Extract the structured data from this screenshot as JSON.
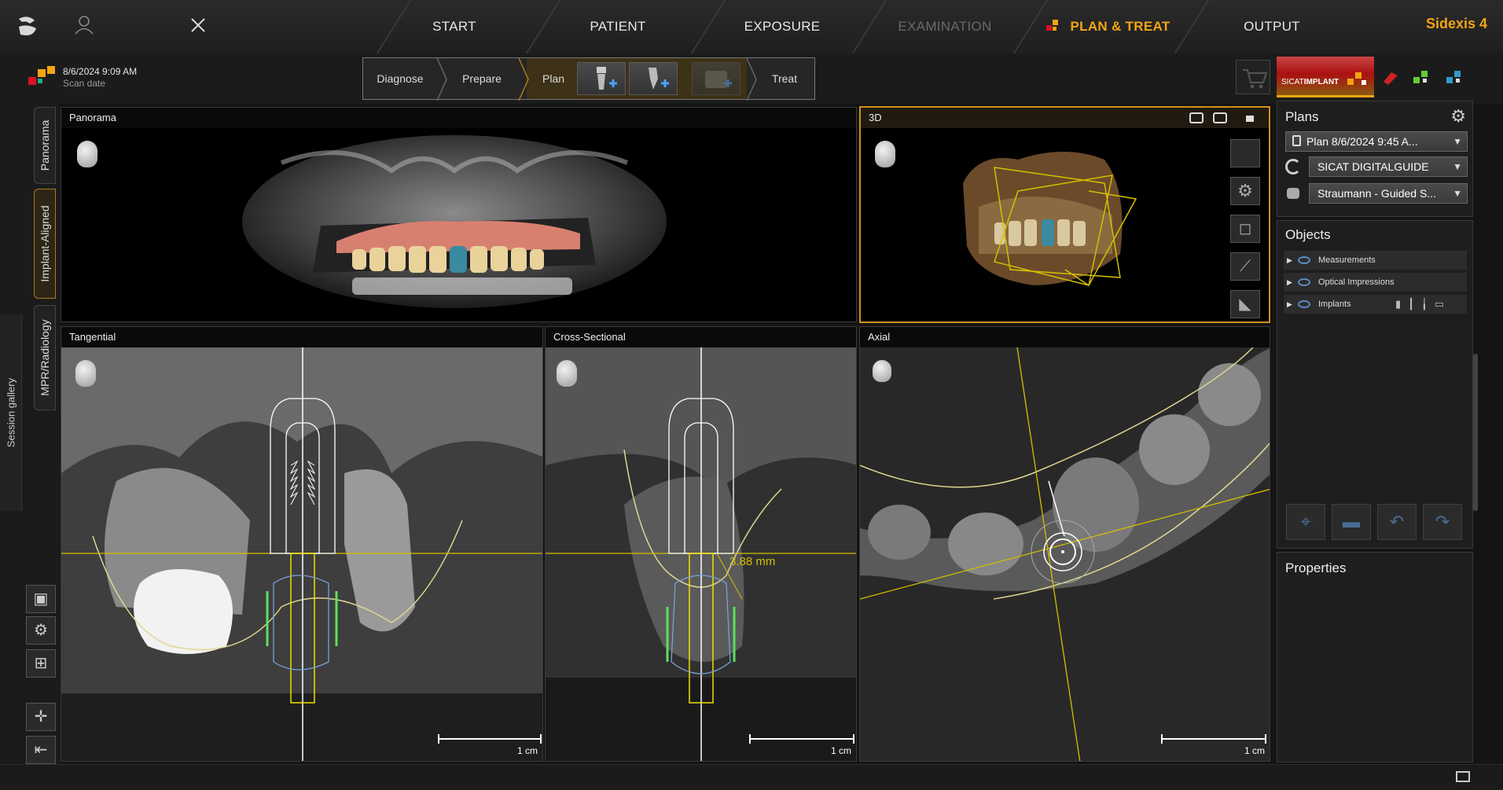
{
  "brand": "Sidexis 4",
  "nav": {
    "start": "START",
    "patient": "PATIENT",
    "exposure": "EXPOSURE",
    "examination": "EXAMINATION",
    "plan_treat": "PLAN & TREAT",
    "output": "OUTPUT"
  },
  "scan": {
    "date": "8/6/2024 9:09 AM",
    "label": "Scan date"
  },
  "workflow": {
    "diagnose": "Diagnose",
    "prepare": "Prepare",
    "plan": "Plan",
    "treat": "Treat"
  },
  "views": {
    "panorama": "Panorama",
    "three_d": "3D",
    "tangential": "Tangential",
    "cross_sectional": "Cross-Sectional",
    "axial": "Axial"
  },
  "measurement": "3.88 mm",
  "scale_label": "1 cm",
  "left_tabs": {
    "panorama": "Panorama",
    "implant_aligned": "Implant-Aligned",
    "mpr": "MPR/Radiology",
    "session_gallery": "Session gallery"
  },
  "sicat": {
    "prefix": "SICAT",
    "name": "IMPLANT"
  },
  "right_panel": {
    "plans_title": "Plans",
    "plan_select": "Plan 8/6/2024 9:45 A...",
    "guide_select": "SICAT DIGITALGUIDE",
    "system_select": "Straumann - Guided S...",
    "objects_title": "Objects",
    "objects": [
      "Measurements",
      "Optical Impressions",
      "Implants"
    ],
    "properties_title": "Properties"
  },
  "colors": {
    "accent": "#f3a512",
    "overlay": "#d4c000",
    "nerve": "#e8e0a0"
  }
}
